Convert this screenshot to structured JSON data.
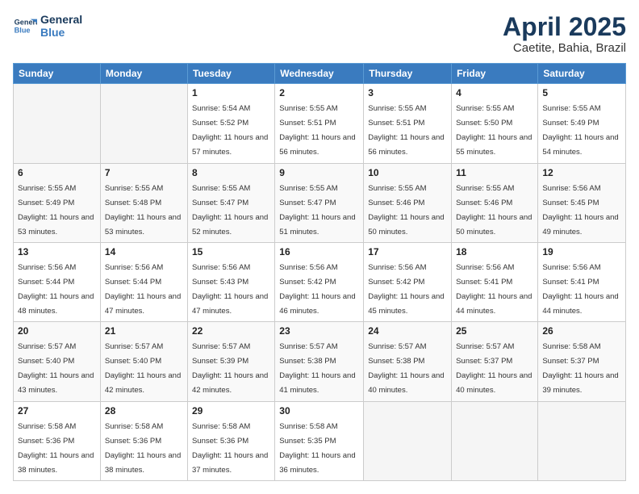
{
  "header": {
    "logo_line1": "General",
    "logo_line2": "Blue",
    "month": "April 2025",
    "location": "Caetite, Bahia, Brazil"
  },
  "days_of_week": [
    "Sunday",
    "Monday",
    "Tuesday",
    "Wednesday",
    "Thursday",
    "Friday",
    "Saturday"
  ],
  "weeks": [
    [
      {
        "day": "",
        "sunrise": "",
        "sunset": "",
        "daylight": ""
      },
      {
        "day": "",
        "sunrise": "",
        "sunset": "",
        "daylight": ""
      },
      {
        "day": "1",
        "sunrise": "Sunrise: 5:54 AM",
        "sunset": "Sunset: 5:52 PM",
        "daylight": "Daylight: 11 hours and 57 minutes."
      },
      {
        "day": "2",
        "sunrise": "Sunrise: 5:55 AM",
        "sunset": "Sunset: 5:51 PM",
        "daylight": "Daylight: 11 hours and 56 minutes."
      },
      {
        "day": "3",
        "sunrise": "Sunrise: 5:55 AM",
        "sunset": "Sunset: 5:51 PM",
        "daylight": "Daylight: 11 hours and 56 minutes."
      },
      {
        "day": "4",
        "sunrise": "Sunrise: 5:55 AM",
        "sunset": "Sunset: 5:50 PM",
        "daylight": "Daylight: 11 hours and 55 minutes."
      },
      {
        "day": "5",
        "sunrise": "Sunrise: 5:55 AM",
        "sunset": "Sunset: 5:49 PM",
        "daylight": "Daylight: 11 hours and 54 minutes."
      }
    ],
    [
      {
        "day": "6",
        "sunrise": "Sunrise: 5:55 AM",
        "sunset": "Sunset: 5:49 PM",
        "daylight": "Daylight: 11 hours and 53 minutes."
      },
      {
        "day": "7",
        "sunrise": "Sunrise: 5:55 AM",
        "sunset": "Sunset: 5:48 PM",
        "daylight": "Daylight: 11 hours and 53 minutes."
      },
      {
        "day": "8",
        "sunrise": "Sunrise: 5:55 AM",
        "sunset": "Sunset: 5:47 PM",
        "daylight": "Daylight: 11 hours and 52 minutes."
      },
      {
        "day": "9",
        "sunrise": "Sunrise: 5:55 AM",
        "sunset": "Sunset: 5:47 PM",
        "daylight": "Daylight: 11 hours and 51 minutes."
      },
      {
        "day": "10",
        "sunrise": "Sunrise: 5:55 AM",
        "sunset": "Sunset: 5:46 PM",
        "daylight": "Daylight: 11 hours and 50 minutes."
      },
      {
        "day": "11",
        "sunrise": "Sunrise: 5:55 AM",
        "sunset": "Sunset: 5:46 PM",
        "daylight": "Daylight: 11 hours and 50 minutes."
      },
      {
        "day": "12",
        "sunrise": "Sunrise: 5:56 AM",
        "sunset": "Sunset: 5:45 PM",
        "daylight": "Daylight: 11 hours and 49 minutes."
      }
    ],
    [
      {
        "day": "13",
        "sunrise": "Sunrise: 5:56 AM",
        "sunset": "Sunset: 5:44 PM",
        "daylight": "Daylight: 11 hours and 48 minutes."
      },
      {
        "day": "14",
        "sunrise": "Sunrise: 5:56 AM",
        "sunset": "Sunset: 5:44 PM",
        "daylight": "Daylight: 11 hours and 47 minutes."
      },
      {
        "day": "15",
        "sunrise": "Sunrise: 5:56 AM",
        "sunset": "Sunset: 5:43 PM",
        "daylight": "Daylight: 11 hours and 47 minutes."
      },
      {
        "day": "16",
        "sunrise": "Sunrise: 5:56 AM",
        "sunset": "Sunset: 5:42 PM",
        "daylight": "Daylight: 11 hours and 46 minutes."
      },
      {
        "day": "17",
        "sunrise": "Sunrise: 5:56 AM",
        "sunset": "Sunset: 5:42 PM",
        "daylight": "Daylight: 11 hours and 45 minutes."
      },
      {
        "day": "18",
        "sunrise": "Sunrise: 5:56 AM",
        "sunset": "Sunset: 5:41 PM",
        "daylight": "Daylight: 11 hours and 44 minutes."
      },
      {
        "day": "19",
        "sunrise": "Sunrise: 5:56 AM",
        "sunset": "Sunset: 5:41 PM",
        "daylight": "Daylight: 11 hours and 44 minutes."
      }
    ],
    [
      {
        "day": "20",
        "sunrise": "Sunrise: 5:57 AM",
        "sunset": "Sunset: 5:40 PM",
        "daylight": "Daylight: 11 hours and 43 minutes."
      },
      {
        "day": "21",
        "sunrise": "Sunrise: 5:57 AM",
        "sunset": "Sunset: 5:40 PM",
        "daylight": "Daylight: 11 hours and 42 minutes."
      },
      {
        "day": "22",
        "sunrise": "Sunrise: 5:57 AM",
        "sunset": "Sunset: 5:39 PM",
        "daylight": "Daylight: 11 hours and 42 minutes."
      },
      {
        "day": "23",
        "sunrise": "Sunrise: 5:57 AM",
        "sunset": "Sunset: 5:38 PM",
        "daylight": "Daylight: 11 hours and 41 minutes."
      },
      {
        "day": "24",
        "sunrise": "Sunrise: 5:57 AM",
        "sunset": "Sunset: 5:38 PM",
        "daylight": "Daylight: 11 hours and 40 minutes."
      },
      {
        "day": "25",
        "sunrise": "Sunrise: 5:57 AM",
        "sunset": "Sunset: 5:37 PM",
        "daylight": "Daylight: 11 hours and 40 minutes."
      },
      {
        "day": "26",
        "sunrise": "Sunrise: 5:58 AM",
        "sunset": "Sunset: 5:37 PM",
        "daylight": "Daylight: 11 hours and 39 minutes."
      }
    ],
    [
      {
        "day": "27",
        "sunrise": "Sunrise: 5:58 AM",
        "sunset": "Sunset: 5:36 PM",
        "daylight": "Daylight: 11 hours and 38 minutes."
      },
      {
        "day": "28",
        "sunrise": "Sunrise: 5:58 AM",
        "sunset": "Sunset: 5:36 PM",
        "daylight": "Daylight: 11 hours and 38 minutes."
      },
      {
        "day": "29",
        "sunrise": "Sunrise: 5:58 AM",
        "sunset": "Sunset: 5:36 PM",
        "daylight": "Daylight: 11 hours and 37 minutes."
      },
      {
        "day": "30",
        "sunrise": "Sunrise: 5:58 AM",
        "sunset": "Sunset: 5:35 PM",
        "daylight": "Daylight: 11 hours and 36 minutes."
      },
      {
        "day": "",
        "sunrise": "",
        "sunset": "",
        "daylight": ""
      },
      {
        "day": "",
        "sunrise": "",
        "sunset": "",
        "daylight": ""
      },
      {
        "day": "",
        "sunrise": "",
        "sunset": "",
        "daylight": ""
      }
    ]
  ]
}
